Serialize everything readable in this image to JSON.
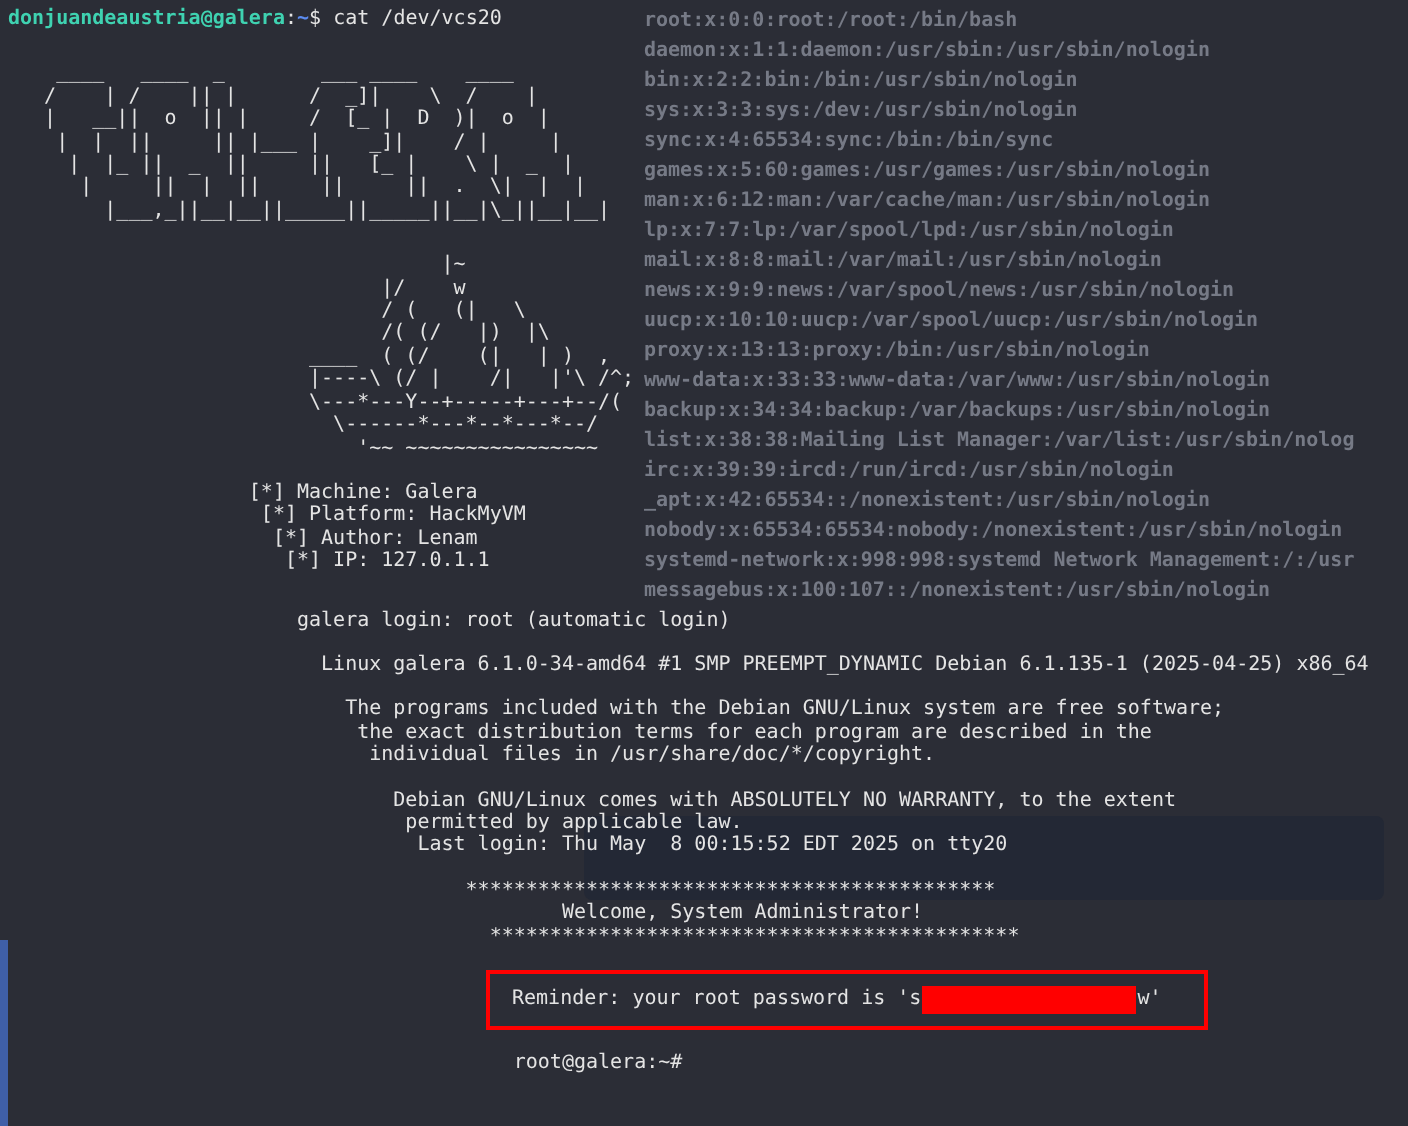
{
  "prompt": {
    "user_host": "donjuandeaustria@galera",
    "separator": ":",
    "path": "~",
    "symbol": "$",
    "command": "cat /dev/vcs20"
  },
  "background_output": [
    "root:x:0:0:root:/root:/bin/bash",
    "daemon:x:1:1:daemon:/usr/sbin:/usr/sbin/nologin",
    "bin:x:2:2:bin:/bin:/usr/sbin/nologin",
    "sys:x:3:3:sys:/dev:/usr/sbin/nologin",
    "sync:x:4:65534:sync:/bin:/bin/sync",
    "games:x:5:60:games:/usr/games:/usr/sbin/nologin",
    "man:x:6:12:man:/var/cache/man:/usr/sbin/nologin",
    "lp:x:7:7:lp:/var/spool/lpd:/usr/sbin/nologin",
    "mail:x:8:8:mail:/var/mail:/usr/sbin/nologin",
    "news:x:9:9:news:/var/spool/news:/usr/sbin/nologin",
    "uucp:x:10:10:uucp:/var/spool/uucp:/usr/sbin/nologin",
    "proxy:x:13:13:proxy:/bin:/usr/sbin/nologin",
    "www-data:x:33:33:www-data:/var/www:/usr/sbin/nologin",
    "backup:x:34:34:backup:/var/backups:/usr/sbin/nologin",
    "list:x:38:38:Mailing List Manager:/var/list:/usr/sbin/nolog",
    "irc:x:39:39:ircd:/run/ircd:/usr/sbin/nologin",
    "_apt:x:42:65534::/nonexistent:/usr/sbin/nologin",
    "nobody:x:65534:65534:nobody:/nonexistent:/usr/sbin/nologin",
    "systemd-network:x:998:998:systemd Network Management:/:/usr",
    "messagebus:x:100:107::/nonexistent:/usr/sbin/nologin"
  ],
  "blocks": [
    {
      "kind": "art",
      "lines": [
        "    ____   ____  _        ___ ____    ____",
        "   /    | /    || |      /  _]|    \\  /    |",
        "   |   __||  o  || |     /  [_ |  D  )|  o  |",
        "    |  |  ||     || |___ |    _]|    / |     |",
        "     |  |_ ||  _  ||     ||   [_ |    \\ |  _  |",
        "      |     ||  |  ||     ||     ||  .  \\|  |  |",
        "        |___,_||__|__||_____||_____||__|\\_||__|__|"
      ]
    },
    {
      "kind": "art",
      "lines": [
        "                                    |~",
        "                               |/    w",
        "                               / (   (|   \\",
        "                               /( (/   |)  |\\",
        "                         ____  ( (/    (|   | )  ,",
        "                         |----\\ (/ |    /|   |'\\ /^;",
        "                         \\---*---Y--+-----+---+--/(",
        "                           \\------*---*--*---*--/",
        "                             '~~ ~~~~~~~~~~~~~~~~"
      ]
    },
    {
      "kind": "text",
      "lines": [
        "                    [*] Machine: Galera",
        "                     [*] Platform: HackMyVM",
        "                      [*] Author: Lenam",
        "                       [*] IP: 127.0.1.1"
      ]
    },
    {
      "kind": "login",
      "lines": [
        "                        galera login: root (automatic login)"
      ]
    },
    {
      "kind": "text",
      "lines": [
        "                          Linux galera 6.1.0-34-amd64 #1 SMP PREEMPT_DYNAMIC Debian 6.1.135-1 (2025-04-25) x86_64"
      ]
    },
    {
      "kind": "text",
      "lines": [
        "                            The programs included with the Debian GNU/Linux system are free software;",
        "                             the exact distribution terms for each program are described in the",
        "                              individual files in /usr/share/doc/*/copyright."
      ]
    },
    {
      "kind": "text",
      "lines": [
        "                                Debian GNU/Linux comes with ABSOLUTELY NO WARRANTY, to the extent",
        "                                 permitted by applicable law.",
        "                                  Last login: Thu May  8 00:15:52 EDT 2025 on tty20"
      ]
    },
    {
      "kind": "text",
      "lines": [
        "                                      ********************************************",
        "                                              Welcome, System Administrator!",
        "                                        ********************************************"
      ]
    },
    {
      "kind": "reminder",
      "before": "Reminder: your root password is 's",
      "after": "w'"
    },
    {
      "kind": "text",
      "lines": [
        "                                          root@galera:~#"
      ]
    }
  ]
}
